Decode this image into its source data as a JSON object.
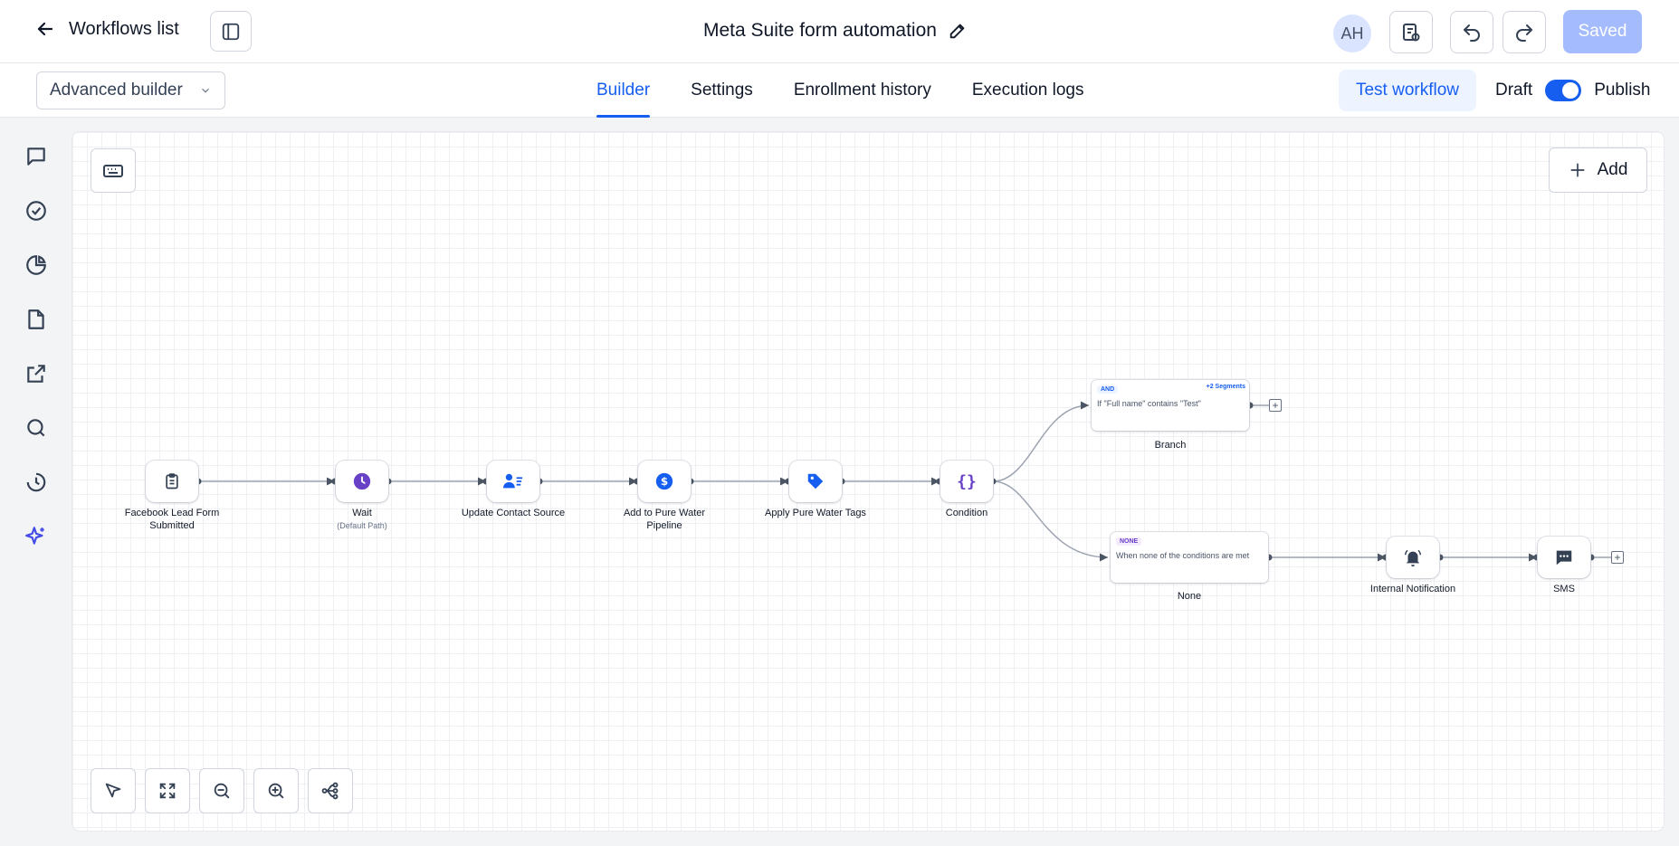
{
  "header": {
    "back_label": "Workflows list",
    "title": "Meta Suite form automation",
    "avatar_initials": "AH",
    "saved_label": "Saved"
  },
  "subbar": {
    "builder_select": "Advanced builder",
    "tabs": [
      {
        "label": "Builder",
        "active": true
      },
      {
        "label": "Settings",
        "active": false
      },
      {
        "label": "Enrollment history",
        "active": false
      },
      {
        "label": "Execution logs",
        "active": false
      }
    ],
    "test_label": "Test workflow",
    "draft_label": "Draft",
    "publish_label": "Publish",
    "publish_toggle_on": true
  },
  "rail": {
    "icons": [
      "chat-icon",
      "check-circle-icon",
      "pie-chart-icon",
      "file-icon",
      "external-link-icon",
      "search-icon",
      "history-icon",
      "sparkles-icon"
    ]
  },
  "canvas": {
    "add_label": "Add",
    "nodes": [
      {
        "label": "Facebook Lead Form Submitted",
        "icon": "clipboard-icon"
      },
      {
        "label": "Wait",
        "sublabel": "(Default Path)",
        "icon": "clock-icon"
      },
      {
        "label": "Update Contact Source",
        "icon": "contact-icon"
      },
      {
        "label": "Add to Pure Water Pipeline",
        "icon": "dollar-icon"
      },
      {
        "label": "Apply Pure Water Tags",
        "icon": "tag-icon"
      },
      {
        "label": "Condition",
        "icon": "braces-icon"
      },
      {
        "label": "Internal Notification",
        "icon": "bell-icon"
      },
      {
        "label": "SMS",
        "icon": "message-icon"
      }
    ],
    "branches": [
      {
        "badge": "AND",
        "segments": "+2 Segments",
        "text": "If \"Full name\" contains \"Test\"",
        "label": "Branch"
      },
      {
        "badge": "NONE",
        "text": "When none of the conditions are met",
        "label": "None"
      }
    ]
  },
  "colors": {
    "accent": "#155eef",
    "saved_button": "#a4bcfd",
    "wait_node": "#6941c6",
    "ai_icon": "#444ce7"
  }
}
